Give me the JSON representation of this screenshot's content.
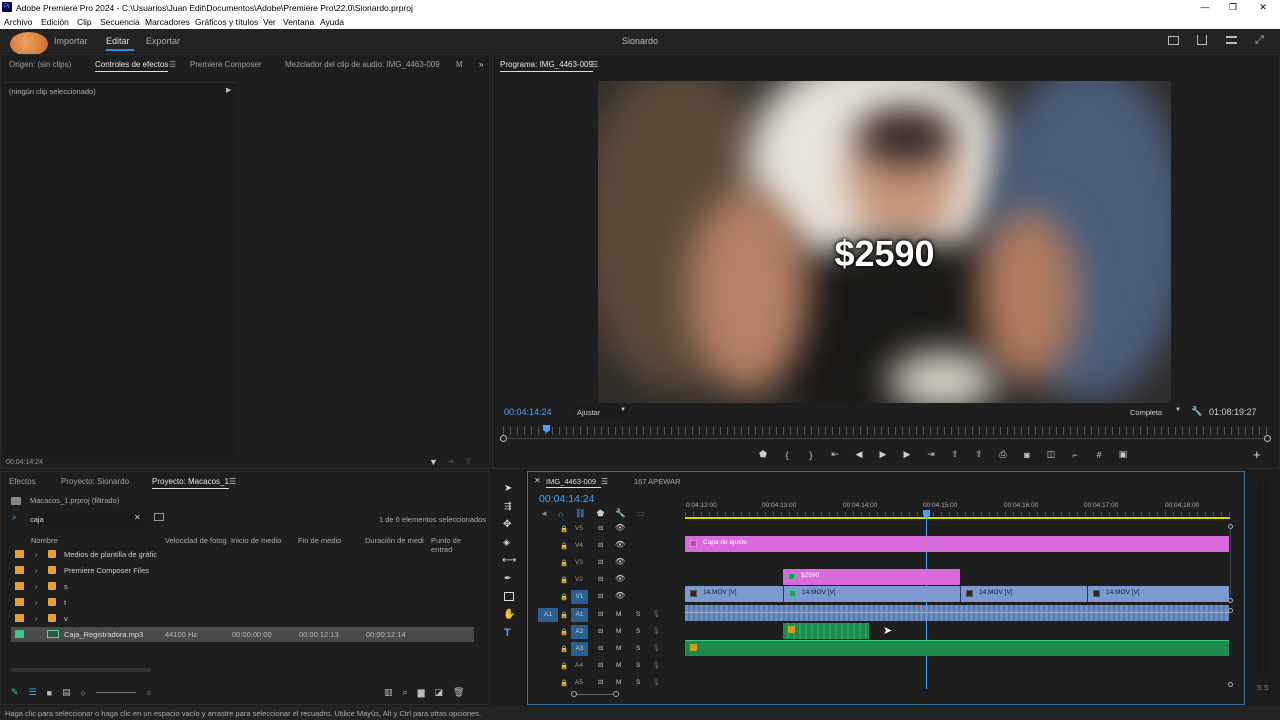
{
  "titlebar": {
    "title": "Adobe Premiere Pro 2024 - C:\\Usuarios\\Juan Edit\\Documentos\\Adobe\\Premiere Pro\\22.0\\Sionardo.prproj",
    "app_badge": "Pr",
    "min": "—",
    "max": "❐",
    "close": "✕"
  },
  "menu": [
    "Archivo",
    "Edición",
    "Clip",
    "Secuencia",
    "Marcadores",
    "Gráficos y títulos",
    "Ver",
    "Ventana",
    "Ayuda"
  ],
  "workspace": {
    "tabs": [
      "Importar",
      "Editar",
      "Exportar"
    ],
    "title": "Sionardo"
  },
  "effect_controls": {
    "tabs": [
      "Origen: (sin clips)",
      "Controles de efectos",
      "Premiere Composer",
      "Mezclador del clip de audio: IMG_4463-009",
      "M"
    ],
    "empty": "(ningún clip seleccionado)",
    "timecode": "00:04:14:24"
  },
  "program": {
    "tab": "Programa: IMG_4463-009",
    "overlay_text": "$2590",
    "timecode": "00:04:14:24",
    "fit": "Ajustar",
    "quality": "Completa",
    "duration": "01:08:19:27"
  },
  "project": {
    "tabs": [
      "Efectos",
      "Proyecto: Sionardo",
      "Proyecto: Macacos_1"
    ],
    "path": "Macacos_1.prproj (filtrado)",
    "search": "caja",
    "count": "1 de 6 elementos seleccionados",
    "columns": [
      "Nombre",
      "Velocidad de fotog",
      "Inicio de medio",
      "Fin de medio",
      "Duración de medi",
      "Punto de entrad"
    ],
    "rows": [
      {
        "name": "Medios de plantilla de gráfic",
        "type": "folder"
      },
      {
        "name": "Premiere Composer Files",
        "type": "folder"
      },
      {
        "name": "s",
        "type": "folder"
      },
      {
        "name": "t",
        "type": "folder"
      },
      {
        "name": "v",
        "type": "folder"
      },
      {
        "name": "Caja_Registradora.mp3",
        "type": "audio",
        "rate": "44100 Hz",
        "start": "00:00:00:00",
        "end": "00:00:12:13",
        "dur": "00:00:12:14"
      }
    ]
  },
  "timeline": {
    "tabs": [
      "IMG_4463-009",
      "167 APEWAR"
    ],
    "timecode": "00:04:14:24",
    "ruler": [
      "0:04:12:00",
      "00:04:13:00",
      "00:04:14:00",
      "00:04:15:00",
      "00:04:16:00",
      "00:04:17:00",
      "00:04:18:00"
    ],
    "video_tracks": [
      "V5",
      "V4",
      "V3",
      "V2",
      "V1"
    ],
    "audio_tracks": [
      "A1",
      "A2",
      "A3",
      "A4",
      "A5"
    ],
    "clips": {
      "adjust": "Capa de ajuste",
      "text": "$2590",
      "v1": [
        "14.MOV [V]",
        "14.MOV [V]",
        "14.MOV [V]",
        "14.MOV [V]"
      ]
    }
  },
  "status": "Haga clic para seleccionar o haga clic en un espacio vacío y arrastre para seleccionar el recuadro. Utilice Mayús, Alt y Ctrl para otras opciones.",
  "meters": "S S",
  "colors": {
    "accent": "#2d8ceb",
    "pink": "#d96ad9",
    "green": "#2a9a5a",
    "blue": "#7a9ad0"
  }
}
